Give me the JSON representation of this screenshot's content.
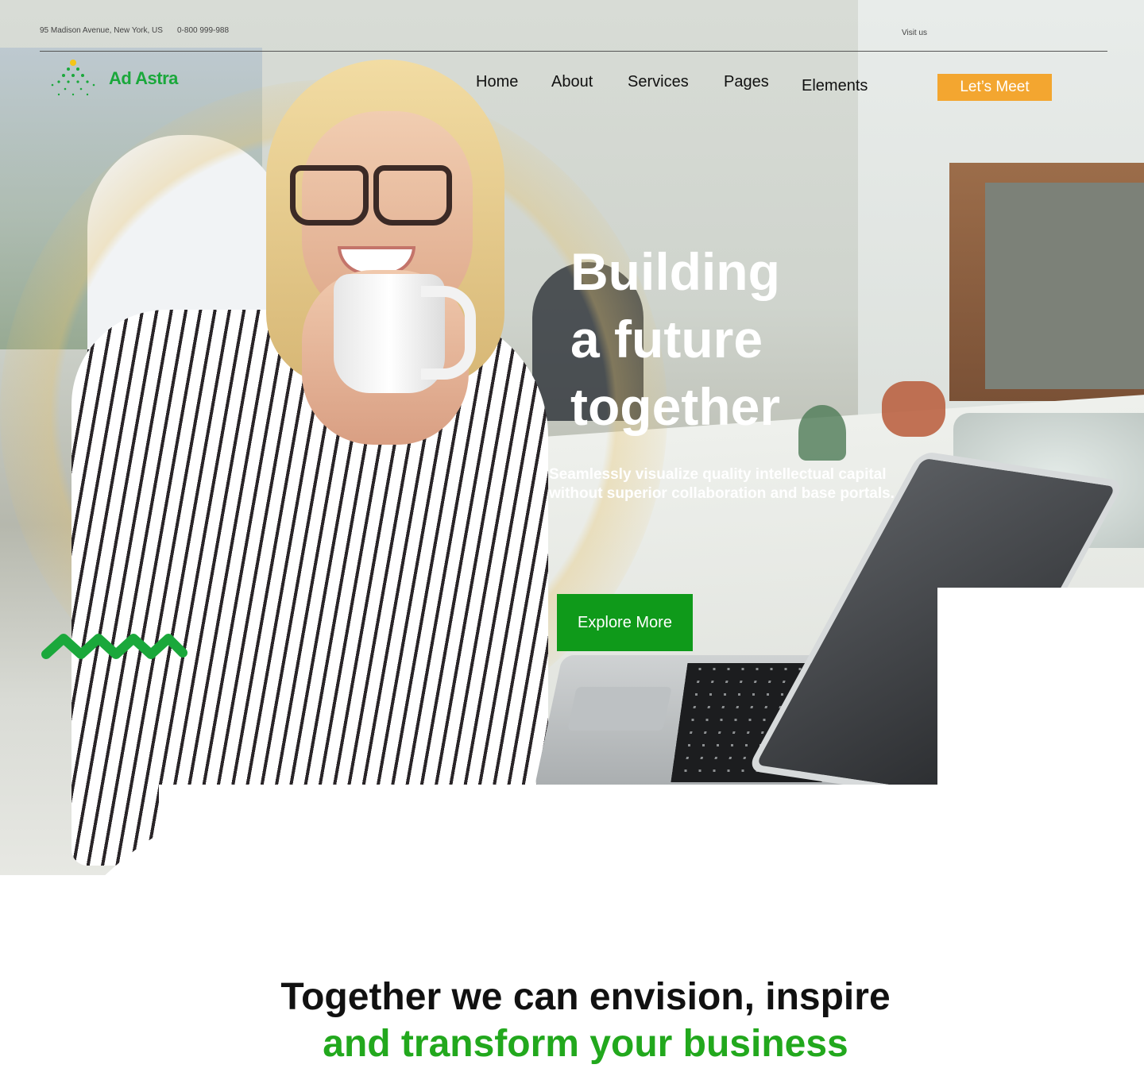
{
  "topbar": {
    "address": "95 Madison Avenue, New York, US",
    "phone": "0-800 999-988",
    "visit": "Visit us"
  },
  "brand": {
    "name": "Ad Astra",
    "accent": "#1aa83b"
  },
  "nav": {
    "items": [
      {
        "label": "Home"
      },
      {
        "label": "About"
      },
      {
        "label": "Services"
      },
      {
        "label": "Pages"
      },
      {
        "label": "Elements"
      }
    ],
    "cta_label": "Let’s Meet",
    "cta_color": "#f3a630"
  },
  "hero": {
    "title_lines": [
      "Building",
      "a future",
      "together"
    ],
    "subtitle_lines": [
      "Seamlessly visualize quality intellectual capital",
      "without superior collaboration and base portals."
    ],
    "cta_label": "Explore More",
    "cta_color": "#0f9a1a"
  },
  "section": {
    "heading_line1": "Together we can envision, inspire",
    "heading_line2": "and transform your business",
    "highlight_color": "#22a81d"
  }
}
